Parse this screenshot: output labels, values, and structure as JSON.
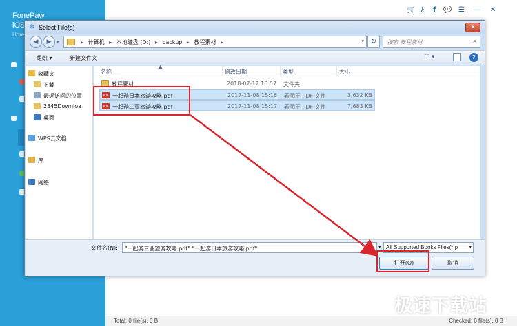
{
  "app": {
    "name_line1": "FonePaw",
    "name_line2": "iOS",
    "name_line3": "Unre",
    "header_icons": [
      "cart-icon",
      "key-icon",
      "facebook-icon",
      "chat-icon",
      "menu-icon",
      "minimize-icon",
      "close-icon"
    ],
    "header_glyphs": [
      "🛒",
      "⚷",
      "f",
      "💬",
      "☰",
      "—",
      "✕"
    ],
    "status_total": "Total: 0 file(s), 0 B",
    "status_checked": "Checked: 0 file(s), 0 B"
  },
  "watermark": "极速下载站",
  "dialog": {
    "title": "Select File(s)",
    "breadcrumbs": [
      "计算机",
      "本地磁盘 (D:)",
      "backup",
      "教程素材"
    ],
    "search_placeholder": "搜索 教程素材",
    "toolbar": {
      "organize": "组织 ▾",
      "new_folder": "新建文件夹"
    },
    "nav_items": [
      {
        "label": "收藏夹",
        "icon": "star-icon",
        "color": "#e9b73a"
      },
      {
        "label": "下载",
        "icon": "download-folder-icon",
        "color": "#e8c560"
      },
      {
        "label": "最近访问的位置",
        "icon": "recent-places-icon",
        "color": "#8aa7c8"
      },
      {
        "label": "2345Downloa",
        "icon": "folder-icon",
        "color": "#e8c560"
      },
      {
        "label": "桌面",
        "icon": "desktop-icon",
        "color": "#3d78c3"
      },
      {
        "label": "WPS云文档",
        "icon": "cloud-icon",
        "color": "#5aa0e0"
      },
      {
        "label": "库",
        "icon": "library-icon",
        "color": "#e2b24a"
      },
      {
        "label": "网络",
        "icon": "network-icon",
        "color": "#3d78c3"
      }
    ],
    "columns": {
      "name": "名称",
      "date": "修改日期",
      "type": "类型",
      "size": "大小"
    },
    "files": [
      {
        "name": "教程素材",
        "date": "2018-07-17 16:57",
        "type": "文件夹",
        "size": "",
        "kind": "folder",
        "selected": false
      },
      {
        "name": "一起游日本旅游攻略.pdf",
        "date": "2017-11-08 15:16",
        "type": "看图王 PDF 文件",
        "size": "3,632 KB",
        "kind": "pdf",
        "selected": true
      },
      {
        "name": "一起游三亚旅游攻略.pdf",
        "date": "2017-11-08 15:17",
        "type": "看图王 PDF 文件",
        "size": "7,683 KB",
        "kind": "pdf",
        "selected": true
      }
    ],
    "filename_label": "文件名(N):",
    "filename_value": "\"一起游三亚旅游攻略.pdf\" \"一起游日本旅游攻略.pdf\"",
    "filetype_value": "All Supported Books Files(*.p",
    "open_button": "打开(O)",
    "cancel_button": "取消"
  }
}
